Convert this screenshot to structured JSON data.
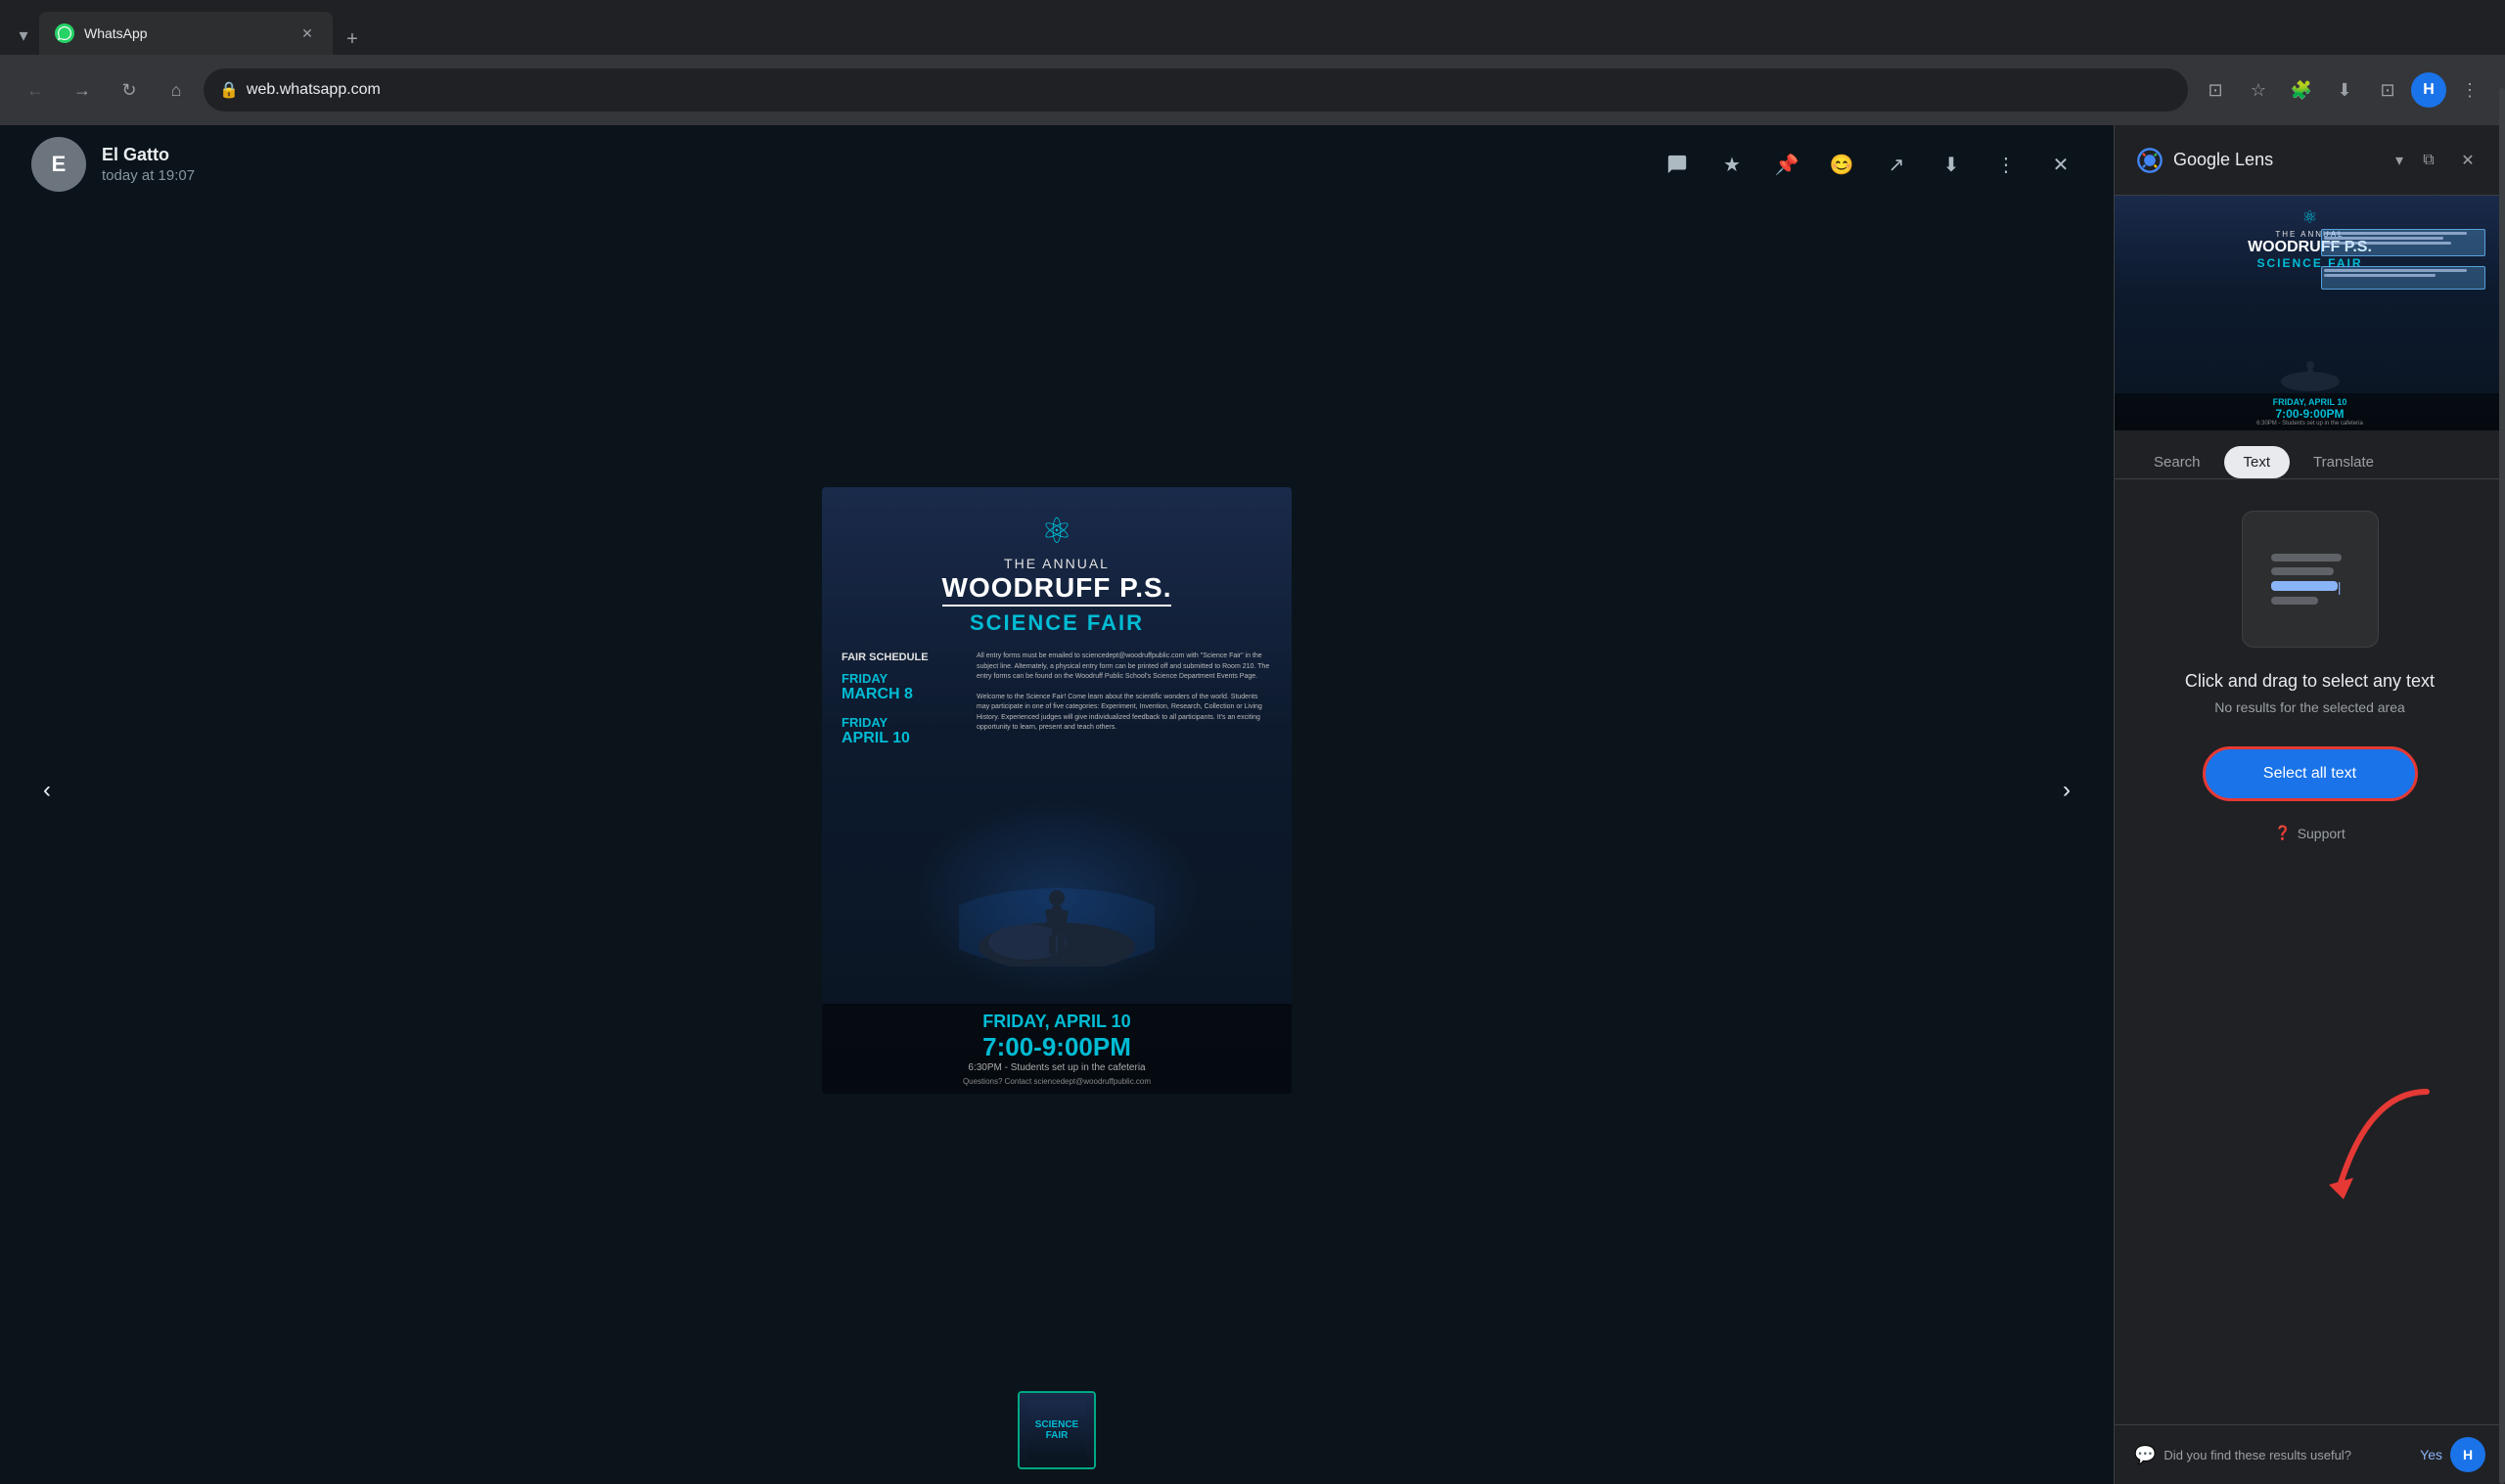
{
  "browser": {
    "tab": {
      "favicon": "W",
      "title": "WhatsApp",
      "close_icon": "✕"
    },
    "new_tab_icon": "+",
    "toolbar": {
      "back_icon": "←",
      "forward_icon": "→",
      "reload_icon": "↻",
      "home_icon": "⌂",
      "url": "web.whatsapp.com",
      "security_icon": "🔒",
      "bookmark_icon": "☆",
      "extensions_icon": "🧩",
      "download_icon": "⬇",
      "zoom_icon": "⊡",
      "profile_letter": "H",
      "menu_icon": "⋮"
    }
  },
  "whatsapp": {
    "sender": {
      "name": "El Gatto",
      "time": "today at 19:07",
      "avatar_letter": "E"
    },
    "header_actions": {
      "speech_bubble": "💬",
      "star": "★",
      "pin": "📌",
      "emoji": "😊",
      "share": "↗",
      "download": "⬇",
      "more": "⋮",
      "close": "✕"
    },
    "nav_left": "‹",
    "nav_right": "›"
  },
  "poster": {
    "icon": "⚛",
    "annual": "THE ANNUAL",
    "school_name": "WOODRUFF P.S.",
    "event": "SCIENCE FAIR",
    "schedule_title": "FAIR SCHEDULE",
    "date1_day": "FRIDAY",
    "date1_date": "MARCH 8",
    "date1_text": "All entry forms must be emailed to sciencedept@woodruffpublic.com with \"Science Fair\" in the subject line. Alternately, a physical entry form can be printed off and submitted to Room 210. The entry forms can be found on the Woodruff Public School's Science Department Events Page.",
    "date2_day": "FRIDAY",
    "date2_date": "APRIL 10",
    "date2_text": "Welcome to the Science Fair! Come learn about the scientific wonders of the world. Students may participate in one of five categories: Experiment, Invention, Research, Collection or Living History. Experienced judges will give individualized feedback to all participants. It's an exciting opportunity to learn, present and teach others.",
    "big_date": "FRIDAY, APRIL 10",
    "big_time": "7:00-9:00PM",
    "setup": "6:30PM - Students set up in the cafeteria",
    "contact": "Questions? Contact",
    "email": "sciencedept@woodruffpublic.com"
  },
  "google_lens": {
    "title": "Google Lens",
    "dropdown_icon": "▾",
    "external_icon": "⧉",
    "close_icon": "✕",
    "tabs": {
      "search": "Search",
      "text": "Text",
      "translate": "Translate"
    },
    "active_tab": "Text",
    "instruction": "Click and drag to select any text",
    "sub_instruction": "No results for the selected area",
    "select_all_button": "Select all text",
    "support_icon": "❓",
    "support_label": "Support",
    "feedback_icon": "💬",
    "feedback_text": "Did you find these results useful?",
    "feedback_yes": "Yes"
  }
}
